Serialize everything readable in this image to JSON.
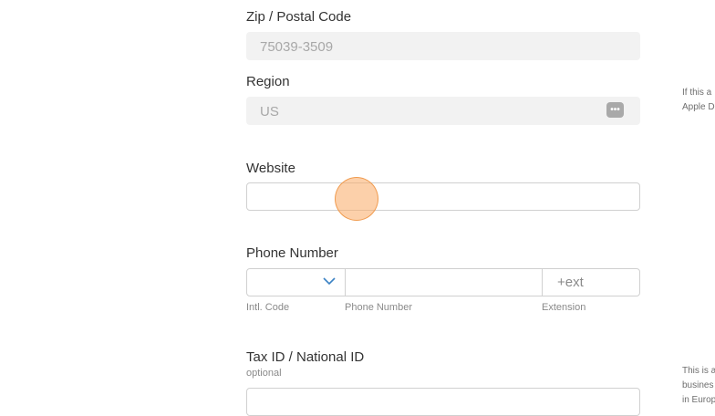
{
  "zip": {
    "label": "Zip / Postal Code",
    "value": "75039-3509"
  },
  "region": {
    "label": "Region",
    "value": "US",
    "button_glyph": "•••"
  },
  "website": {
    "label": "Website",
    "value": ""
  },
  "phone": {
    "label": "Phone Number",
    "code_value": "",
    "number_value": "",
    "ext_placeholder": "+ext",
    "sub_code": "Intl. Code",
    "sub_number": "Phone Number",
    "sub_ext": "Extension"
  },
  "tax": {
    "label": "Tax ID / National ID",
    "optional": "optional",
    "value": ""
  },
  "side_notes": {
    "note1_line1": "If this a",
    "note1_line2": "Apple D",
    "note2_line1": "This is a",
    "note2_line2": "busines",
    "note2_line3": "in Europ"
  },
  "colors": {
    "accent": "#3b82c4",
    "cursor": "#f7a35c"
  },
  "icons": {
    "region_menu": "ellipsis-icon",
    "dropdown": "chevron-down-icon"
  }
}
